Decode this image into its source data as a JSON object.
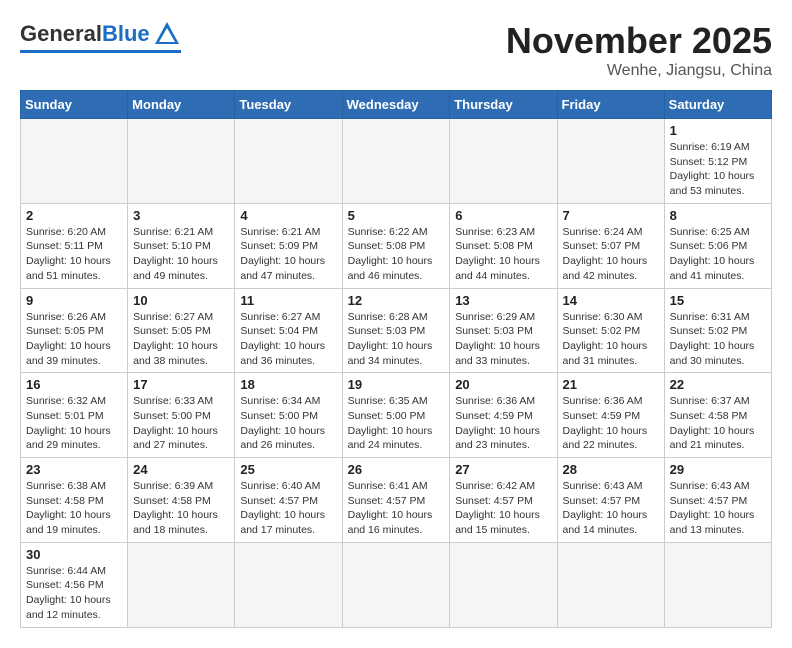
{
  "header": {
    "logo_general": "General",
    "logo_blue": "Blue",
    "month_title": "November 2025",
    "location": "Wenhe, Jiangsu, China"
  },
  "weekdays": [
    "Sunday",
    "Monday",
    "Tuesday",
    "Wednesday",
    "Thursday",
    "Friday",
    "Saturday"
  ],
  "weeks": [
    {
      "days": [
        {
          "num": "",
          "info": ""
        },
        {
          "num": "",
          "info": ""
        },
        {
          "num": "",
          "info": ""
        },
        {
          "num": "",
          "info": ""
        },
        {
          "num": "",
          "info": ""
        },
        {
          "num": "",
          "info": ""
        },
        {
          "num": "1",
          "info": "Sunrise: 6:19 AM\nSunset: 5:12 PM\nDaylight: 10 hours and 53 minutes."
        }
      ]
    },
    {
      "days": [
        {
          "num": "2",
          "info": "Sunrise: 6:20 AM\nSunset: 5:11 PM\nDaylight: 10 hours and 51 minutes."
        },
        {
          "num": "3",
          "info": "Sunrise: 6:21 AM\nSunset: 5:10 PM\nDaylight: 10 hours and 49 minutes."
        },
        {
          "num": "4",
          "info": "Sunrise: 6:21 AM\nSunset: 5:09 PM\nDaylight: 10 hours and 47 minutes."
        },
        {
          "num": "5",
          "info": "Sunrise: 6:22 AM\nSunset: 5:08 PM\nDaylight: 10 hours and 46 minutes."
        },
        {
          "num": "6",
          "info": "Sunrise: 6:23 AM\nSunset: 5:08 PM\nDaylight: 10 hours and 44 minutes."
        },
        {
          "num": "7",
          "info": "Sunrise: 6:24 AM\nSunset: 5:07 PM\nDaylight: 10 hours and 42 minutes."
        },
        {
          "num": "8",
          "info": "Sunrise: 6:25 AM\nSunset: 5:06 PM\nDaylight: 10 hours and 41 minutes."
        }
      ]
    },
    {
      "days": [
        {
          "num": "9",
          "info": "Sunrise: 6:26 AM\nSunset: 5:05 PM\nDaylight: 10 hours and 39 minutes."
        },
        {
          "num": "10",
          "info": "Sunrise: 6:27 AM\nSunset: 5:05 PM\nDaylight: 10 hours and 38 minutes."
        },
        {
          "num": "11",
          "info": "Sunrise: 6:27 AM\nSunset: 5:04 PM\nDaylight: 10 hours and 36 minutes."
        },
        {
          "num": "12",
          "info": "Sunrise: 6:28 AM\nSunset: 5:03 PM\nDaylight: 10 hours and 34 minutes."
        },
        {
          "num": "13",
          "info": "Sunrise: 6:29 AM\nSunset: 5:03 PM\nDaylight: 10 hours and 33 minutes."
        },
        {
          "num": "14",
          "info": "Sunrise: 6:30 AM\nSunset: 5:02 PM\nDaylight: 10 hours and 31 minutes."
        },
        {
          "num": "15",
          "info": "Sunrise: 6:31 AM\nSunset: 5:02 PM\nDaylight: 10 hours and 30 minutes."
        }
      ]
    },
    {
      "days": [
        {
          "num": "16",
          "info": "Sunrise: 6:32 AM\nSunset: 5:01 PM\nDaylight: 10 hours and 29 minutes."
        },
        {
          "num": "17",
          "info": "Sunrise: 6:33 AM\nSunset: 5:00 PM\nDaylight: 10 hours and 27 minutes."
        },
        {
          "num": "18",
          "info": "Sunrise: 6:34 AM\nSunset: 5:00 PM\nDaylight: 10 hours and 26 minutes."
        },
        {
          "num": "19",
          "info": "Sunrise: 6:35 AM\nSunset: 5:00 PM\nDaylight: 10 hours and 24 minutes."
        },
        {
          "num": "20",
          "info": "Sunrise: 6:36 AM\nSunset: 4:59 PM\nDaylight: 10 hours and 23 minutes."
        },
        {
          "num": "21",
          "info": "Sunrise: 6:36 AM\nSunset: 4:59 PM\nDaylight: 10 hours and 22 minutes."
        },
        {
          "num": "22",
          "info": "Sunrise: 6:37 AM\nSunset: 4:58 PM\nDaylight: 10 hours and 21 minutes."
        }
      ]
    },
    {
      "days": [
        {
          "num": "23",
          "info": "Sunrise: 6:38 AM\nSunset: 4:58 PM\nDaylight: 10 hours and 19 minutes."
        },
        {
          "num": "24",
          "info": "Sunrise: 6:39 AM\nSunset: 4:58 PM\nDaylight: 10 hours and 18 minutes."
        },
        {
          "num": "25",
          "info": "Sunrise: 6:40 AM\nSunset: 4:57 PM\nDaylight: 10 hours and 17 minutes."
        },
        {
          "num": "26",
          "info": "Sunrise: 6:41 AM\nSunset: 4:57 PM\nDaylight: 10 hours and 16 minutes."
        },
        {
          "num": "27",
          "info": "Sunrise: 6:42 AM\nSunset: 4:57 PM\nDaylight: 10 hours and 15 minutes."
        },
        {
          "num": "28",
          "info": "Sunrise: 6:43 AM\nSunset: 4:57 PM\nDaylight: 10 hours and 14 minutes."
        },
        {
          "num": "29",
          "info": "Sunrise: 6:43 AM\nSunset: 4:57 PM\nDaylight: 10 hours and 13 minutes."
        }
      ]
    },
    {
      "days": [
        {
          "num": "30",
          "info": "Sunrise: 6:44 AM\nSunset: 4:56 PM\nDaylight: 10 hours and 12 minutes."
        },
        {
          "num": "",
          "info": ""
        },
        {
          "num": "",
          "info": ""
        },
        {
          "num": "",
          "info": ""
        },
        {
          "num": "",
          "info": ""
        },
        {
          "num": "",
          "info": ""
        },
        {
          "num": "",
          "info": ""
        }
      ]
    }
  ]
}
